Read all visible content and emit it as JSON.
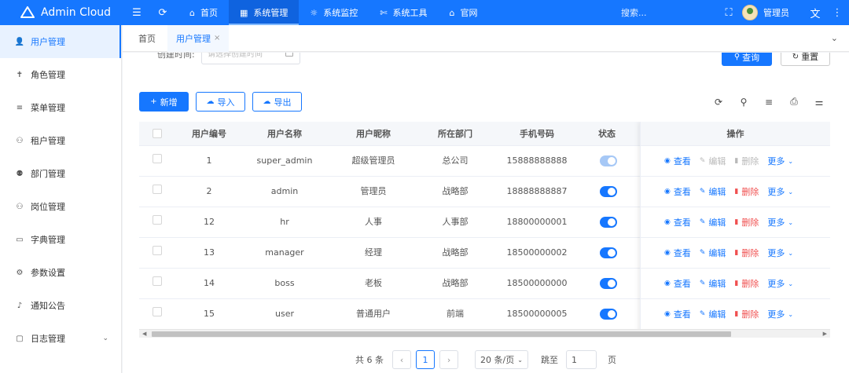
{
  "brand": {
    "name": "Admin Cloud",
    "logo_icon": "cloud-icon"
  },
  "topbar": {
    "nav": [
      {
        "icon": "⌂",
        "label": "首页"
      },
      {
        "icon": "▦",
        "label": "系统管理"
      },
      {
        "icon": "☼",
        "label": "系统监控"
      },
      {
        "icon": "✄",
        "label": "系统工具"
      },
      {
        "icon": "⌂",
        "label": "官网"
      }
    ],
    "search_placeholder": "搜索...",
    "user_name": "管理员"
  },
  "sidebar": {
    "items": [
      {
        "icon": "👤",
        "label": "用户管理"
      },
      {
        "icon": "✝",
        "label": "角色管理"
      },
      {
        "icon": "≡",
        "label": "菜单管理"
      },
      {
        "icon": "⚇",
        "label": "租户管理"
      },
      {
        "icon": "⚉",
        "label": "部门管理"
      },
      {
        "icon": "⚇",
        "label": "岗位管理"
      },
      {
        "icon": "▭",
        "label": "字典管理"
      },
      {
        "icon": "⚙",
        "label": "参数设置"
      },
      {
        "icon": "♪",
        "label": "通知公告"
      },
      {
        "icon": "▢",
        "label": "日志管理"
      }
    ]
  },
  "tabs": [
    {
      "label": "首页"
    },
    {
      "label": "用户管理"
    }
  ],
  "filter": {
    "create_time_label": "创建时间:",
    "create_time_placeholder": "请选择创建时间",
    "query_label": "查询",
    "reset_label": "重置"
  },
  "toolbar": {
    "add_label": "新增",
    "import_label": "导入",
    "export_label": "导出"
  },
  "table": {
    "columns": [
      "用户编号",
      "用户名称",
      "用户昵称",
      "所在部门",
      "手机号码",
      "状态",
      "操作"
    ],
    "actions": {
      "view": "查看",
      "edit": "编辑",
      "delete": "删除",
      "more": "更多"
    },
    "rows": [
      {
        "id": "1",
        "username": "super_admin",
        "nickname": "超级管理员",
        "dept": "总公司",
        "phone": "15888888888",
        "status_on": true,
        "editable": false
      },
      {
        "id": "2",
        "username": "admin",
        "nickname": "管理员",
        "dept": "战略部",
        "phone": "18888888887",
        "status_on": true,
        "editable": true
      },
      {
        "id": "12",
        "username": "hr",
        "nickname": "人事",
        "dept": "人事部",
        "phone": "18800000001",
        "status_on": true,
        "editable": true
      },
      {
        "id": "13",
        "username": "manager",
        "nickname": "经理",
        "dept": "战略部",
        "phone": "18500000002",
        "status_on": true,
        "editable": true
      },
      {
        "id": "14",
        "username": "boss",
        "nickname": "老板",
        "dept": "战略部",
        "phone": "18500000000",
        "status_on": true,
        "editable": true
      },
      {
        "id": "15",
        "username": "user",
        "nickname": "普通用户",
        "dept": "前端",
        "phone": "18500000005",
        "status_on": true,
        "editable": true
      }
    ]
  },
  "pagination": {
    "total": "共 6 条",
    "current_page": "1",
    "page_size": "20 条/页",
    "goto_label": "跳至",
    "goto_value": "1",
    "page_suffix": "页"
  },
  "colors": {
    "primary": "#1677ff",
    "danger": "#f04f4f"
  }
}
